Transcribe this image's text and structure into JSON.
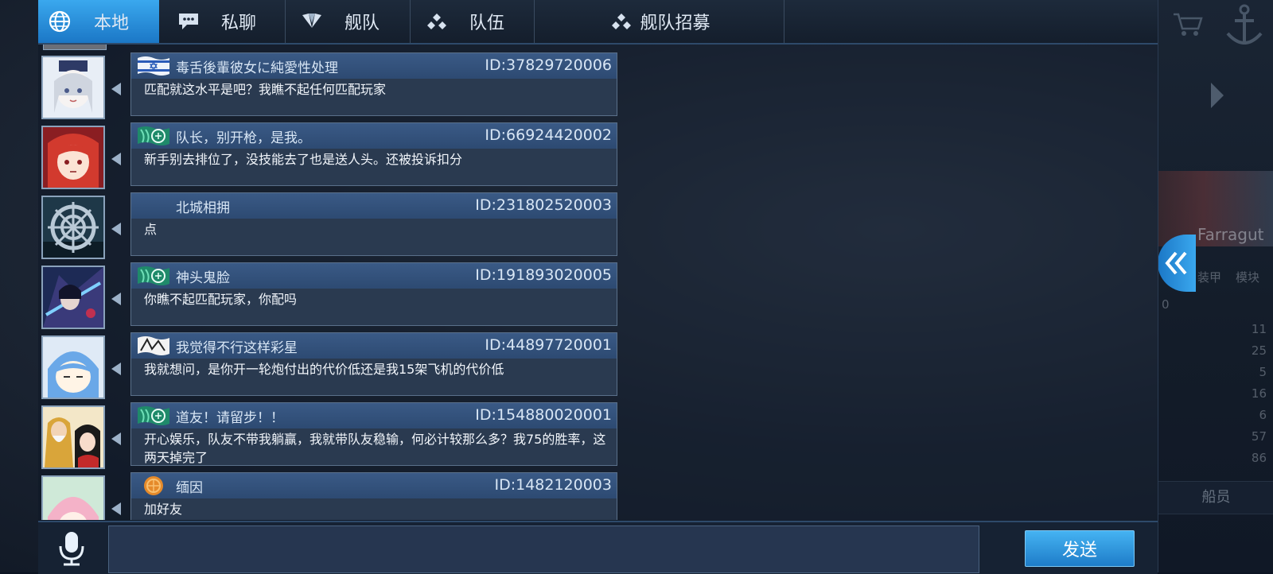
{
  "tabs": [
    {
      "label": "本地",
      "icon": "globe-icon",
      "active": true
    },
    {
      "label": "私聊",
      "icon": "speech-bubble-icon",
      "active": false
    },
    {
      "label": "舰队",
      "icon": "fleet-emblem-icon",
      "active": false
    },
    {
      "label": "队伍",
      "icon": "team-dots-icon",
      "active": false
    },
    {
      "label": "舰队招募",
      "icon": "team-dots-icon",
      "active": false
    }
  ],
  "messages": [
    {
      "name": "毒舌後輩彼女に純愛性处理",
      "id": "ID:37829720006",
      "text": "匹配就这水平是吧？我瞧不起任何匹配玩家",
      "badge": "israel-flag-badge",
      "avatar": "white-hair-girl-avatar"
    },
    {
      "name": "队长，别开枪，是我。",
      "id": "ID:66924420002",
      "text": "新手别去排位了，没技能去了也是送人头。还被投诉扣分",
      "badge": "green-wave-badge",
      "avatar": "red-hair-girl-avatar"
    },
    {
      "name": "北城相拥",
      "id": "ID:231802520003",
      "text": "点",
      "badge": "",
      "avatar": "ship-wheel-avatar"
    },
    {
      "name": "神头鬼脸",
      "id": "ID:191893020005",
      "text": "你瞧不起匹配玩家，你配吗",
      "badge": "green-wave-badge",
      "avatar": "dark-warrior-avatar"
    },
    {
      "name": "我觉得不行这样彩星",
      "id": "ID:44897720001",
      "text": "我就想问，是你开一轮炮付出的代价低还是我15架飞机的代价低",
      "badge": "white-flag-badge",
      "avatar": "blue-hair-chibi-avatar"
    },
    {
      "name": "道友！请留步！！",
      "id": "ID:154880020001",
      "text": "开心娱乐，队友不带我躺赢，我就带队友稳输，何必计较那么多？我75的胜率，这两天掉完了",
      "badge": "green-wave-badge",
      "avatar": "old-man-woman-avatar"
    },
    {
      "name": "缅因",
      "id": "ID:1482120003",
      "text": "加好友",
      "badge": "orange-seal-badge",
      "avatar": "pink-hair-girl-avatar"
    }
  ],
  "input": {
    "value": "",
    "placeholder": ""
  },
  "send_label": "发送",
  "side_panel": {
    "ship_name": "Farragut",
    "labels": [
      "装甲",
      "模块",
      "船员"
    ],
    "level_value": "0",
    "stat_values": [
      "11",
      "25",
      "5",
      "16",
      "6",
      "57",
      "86"
    ]
  },
  "colors": {
    "accent": "#2b8fdc",
    "tab_active": "#3aa8ee",
    "bubble_header": "#3a5a86",
    "bubble_body": "#2a3a50"
  }
}
